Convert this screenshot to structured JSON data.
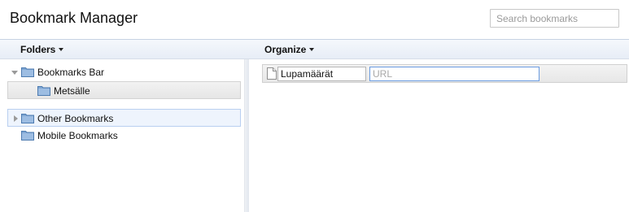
{
  "header": {
    "title": "Bookmark Manager",
    "search_placeholder": "Search bookmarks"
  },
  "toolbar": {
    "folders_label": "Folders",
    "organize_label": "Organize"
  },
  "tree": {
    "items": [
      {
        "label": "Bookmarks Bar",
        "expanded": true,
        "icon": "folder-icon"
      },
      {
        "label": "Metsälle",
        "selected": true,
        "icon": "folder-icon"
      },
      {
        "label": "Other Bookmarks",
        "expanded": false,
        "icon": "folder-icon"
      },
      {
        "label": "Mobile Bookmarks",
        "icon": "folder-icon"
      }
    ]
  },
  "editor": {
    "name_value": "Lupamäärät",
    "url_value": "",
    "url_placeholder": "URL",
    "icon": "page-icon"
  },
  "colors": {
    "folder_fill": "#7fa6d3",
    "accent_border": "#6a9be0",
    "toolbar_top": "#f5f8fc",
    "toolbar_bottom": "#e7edf6"
  }
}
